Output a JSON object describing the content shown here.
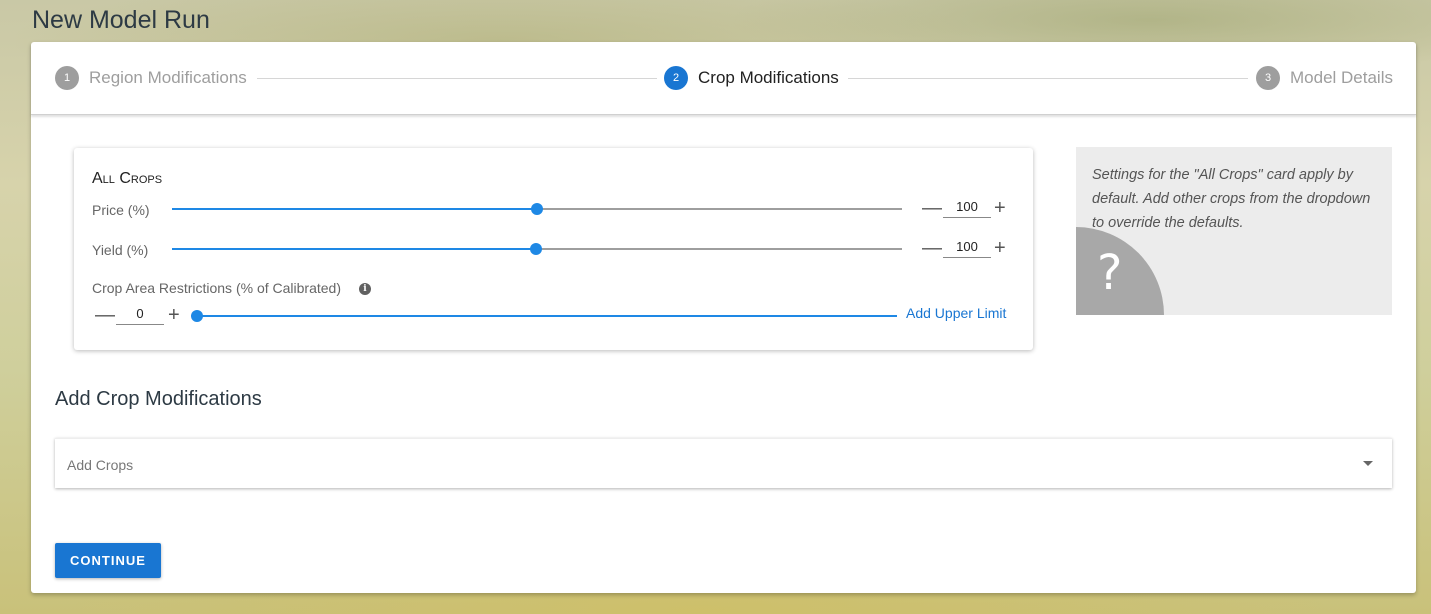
{
  "page": {
    "title": "New Model Run"
  },
  "stepper": {
    "steps": [
      {
        "number": "1",
        "label": "Region Modifications",
        "state": "inactive"
      },
      {
        "number": "2",
        "label": "Crop Modifications",
        "state": "active"
      },
      {
        "number": "3",
        "label": "Model Details",
        "state": "inactive"
      }
    ]
  },
  "all_crops": {
    "title": "All Crops",
    "price": {
      "label": "Price (%)",
      "value": "100",
      "slider_fraction": 0.5
    },
    "yield": {
      "label": "Yield (%)",
      "value": "100",
      "slider_fraction": 0.5
    },
    "area": {
      "label": "Crop Area Restrictions (% of Calibrated)",
      "value": "0",
      "add_upper_limit": "Add Upper Limit"
    }
  },
  "help": {
    "text": "Settings for the \"All Crops\" card apply by default. Add other crops from the dropdown to override the defaults.",
    "icon": "question-mark-icon"
  },
  "add_crop": {
    "title": "Add Crop Modifications",
    "placeholder": "Add Crops"
  },
  "continue_label": "CONTINUE",
  "colors": {
    "accent": "#1976d2",
    "slider": "#1e88e5",
    "inactive_step": "#9e9e9e"
  }
}
